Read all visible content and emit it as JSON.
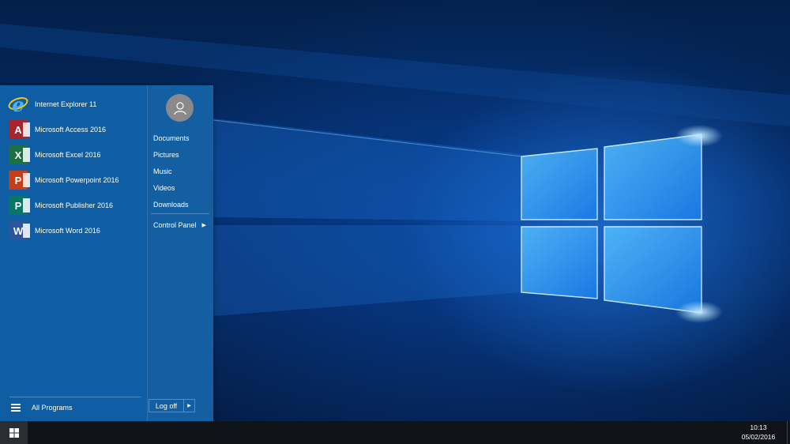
{
  "start_menu": {
    "pinned": [
      {
        "label": "Internet Explorer 11",
        "icon": "internet-explorer-icon",
        "letter": "e",
        "color": "#49b4f5"
      },
      {
        "label": "Microsoft Access 2016",
        "icon": "access-icon",
        "letter": "A",
        "color": "#a4262c"
      },
      {
        "label": "Microsoft Excel 2016",
        "icon": "excel-icon",
        "letter": "X",
        "color": "#1d7044"
      },
      {
        "label": "Microsoft Powerpoint 2016",
        "icon": "powerpoint-icon",
        "letter": "P",
        "color": "#c43e1c"
      },
      {
        "label": "Microsoft Publisher 2016",
        "icon": "publisher-icon",
        "letter": "P",
        "color": "#077568"
      },
      {
        "label": "Microsoft Word 2016",
        "icon": "word-icon",
        "letter": "W",
        "color": "#2b579a"
      }
    ],
    "all_programs": "All Programs",
    "places": [
      {
        "label": "Documents"
      },
      {
        "label": "Pictures"
      },
      {
        "label": "Music"
      },
      {
        "label": "Videos"
      },
      {
        "label": "Downloads"
      }
    ],
    "control_panel": "Control Panel",
    "logoff": "Log off",
    "accent_color": "#1161a7"
  },
  "taskbar": {
    "time": "10:13",
    "date": "05/02/2016"
  }
}
